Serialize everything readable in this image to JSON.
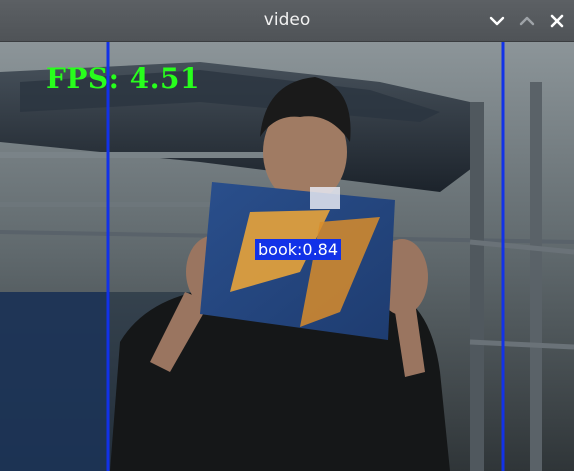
{
  "window": {
    "title": "video",
    "controls": {
      "minimize_icon": "chevron-down-icon",
      "maximize_icon": "chevron-up-icon",
      "close_icon": "close-icon"
    }
  },
  "video": {
    "fps_text": "FPS: 4.51",
    "detection": {
      "label": "book:0.84",
      "class": "book",
      "confidence": 0.84
    },
    "colors": {
      "fps_text": "#28ff1c",
      "detection_box": "#1232e8",
      "detection_label_text": "#ffffff"
    }
  }
}
